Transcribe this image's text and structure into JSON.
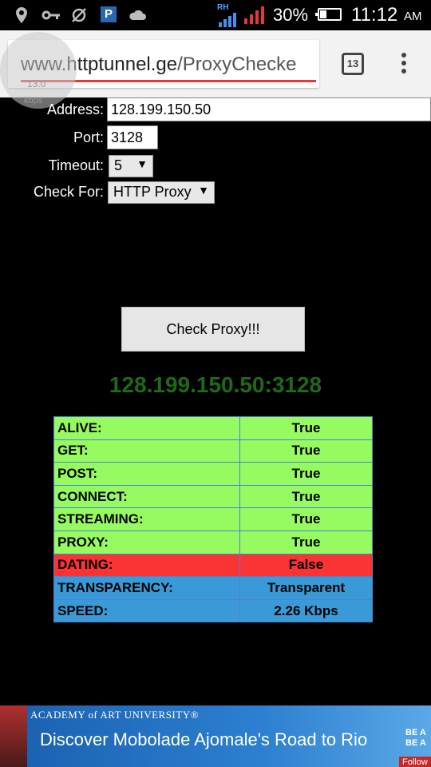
{
  "status_bar": {
    "battery_percent": "30%",
    "time": "11:12",
    "ampm": "AM",
    "network_label": "RH"
  },
  "browser": {
    "url_host": "www.httptunnel.ge",
    "url_path": "/ProxyChecke",
    "tab_count": "13",
    "speed_badge_value": "13.0",
    "speed_badge_unit": "kbps"
  },
  "form": {
    "address_label": "Address:",
    "address_value": "128.199.150.50",
    "port_label": "Port:",
    "port_value": "3128",
    "timeout_label": "Timeout:",
    "timeout_value": "5",
    "checkfor_label": "Check For:",
    "checkfor_value": "HTTP Proxy",
    "check_button": "Check Proxy!!!"
  },
  "result": {
    "title": "128.199.150.50:3128",
    "rows": [
      {
        "label": "ALIVE:",
        "value": "True"
      },
      {
        "label": "GET:",
        "value": "True"
      },
      {
        "label": "POST:",
        "value": "True"
      },
      {
        "label": "CONNECT:",
        "value": "True"
      },
      {
        "label": "STREAMING:",
        "value": "True"
      },
      {
        "label": "PROXY:",
        "value": "True"
      },
      {
        "label": "DATING:",
        "value": "False"
      },
      {
        "label": "TRANSPARENCY:",
        "value": "Transparent"
      },
      {
        "label": "SPEED:",
        "value": "2.26 Kbps"
      }
    ]
  },
  "ad": {
    "brand": "ACADEMY of ART UNIVERSITY®",
    "headline": "Discover Mobolade Ajomale's Road to Rio",
    "side_text": "BE A BE A",
    "follow": "Follow H"
  },
  "colors": {
    "alive_green": "#96fb60",
    "false_red": "#fa3434",
    "info_blue": "#3a9ad8",
    "result_title_green": "#1d6b16"
  }
}
